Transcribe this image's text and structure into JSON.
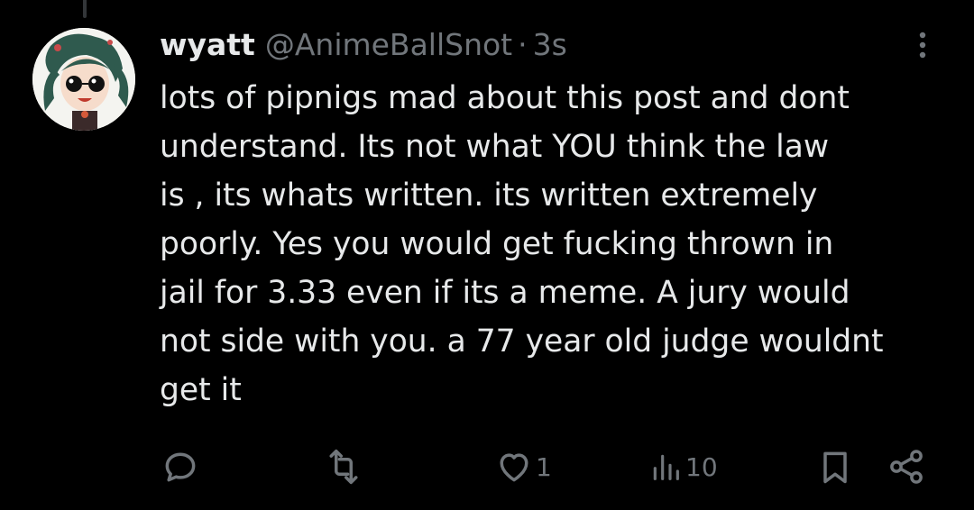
{
  "tweet": {
    "author_name": "wyatt",
    "handle": "@AnimeBallSnot",
    "separator": "·",
    "timestamp": "3s",
    "text": "lots of pipnigs mad about this post and dont\nunderstand. Its not what YOU think the law\nis , its whats written. its written extremely\npoorly. Yes you would get fucking thrown in\njail for 3.33 even if its a meme. A jury would\nnot side with you. a 77 year old judge wouldnt\nget it"
  },
  "actions": {
    "reply_count": "",
    "repost_count": "",
    "like_count": "1",
    "views_count": "10"
  },
  "icons": {
    "reply": "reply-icon",
    "repost": "repost-icon",
    "like": "heart-icon",
    "views": "views-chart-icon",
    "bookmark": "bookmark-icon",
    "share": "share-icon",
    "more": "more-vertical-icon"
  },
  "colors": {
    "background": "#000000",
    "primary_text": "#e7e9ea",
    "secondary_text": "#71767b",
    "thread_line": "#333639"
  }
}
